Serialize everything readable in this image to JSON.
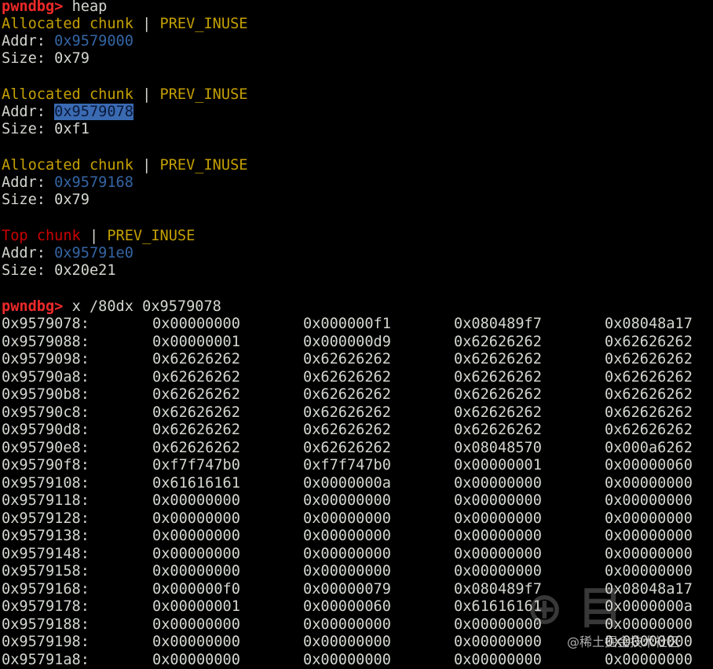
{
  "heap_cmd": {
    "prompt": "pwndbg>",
    "command": " heap"
  },
  "chunks": [
    {
      "title": "Allocated chunk",
      "sep": " | ",
      "flag": "PREV_INUSE",
      "addr_label": "Addr: ",
      "addr": "0x9579000",
      "size_label": "Size: ",
      "size": "0x79"
    },
    {
      "title": "Allocated chunk",
      "sep": " | ",
      "flag": "PREV_INUSE",
      "addr_label": "Addr: ",
      "addr": "0x9579078",
      "size_label": "Size: ",
      "size": "0xf1"
    },
    {
      "title": "Allocated chunk",
      "sep": " | ",
      "flag": "PREV_INUSE",
      "addr_label": "Addr: ",
      "addr": "0x9579168",
      "size_label": "Size: ",
      "size": "0x79"
    },
    {
      "title": "Top chunk",
      "sep": " | ",
      "flag": "PREV_INUSE",
      "addr_label": "Addr: ",
      "addr": "0x95791e0",
      "size_label": "Size: ",
      "size": "0x20e21"
    }
  ],
  "dump_cmd": {
    "prompt": "pwndbg>",
    "command": " x /80dx 0x9579078"
  },
  "dump_rows": [
    [
      "0x9579078:",
      "0x00000000",
      "0x000000f1",
      "0x080489f7",
      "0x08048a17"
    ],
    [
      "0x9579088:",
      "0x00000001",
      "0x000000d9",
      "0x62626262",
      "0x62626262"
    ],
    [
      "0x9579098:",
      "0x62626262",
      "0x62626262",
      "0x62626262",
      "0x62626262"
    ],
    [
      "0x95790a8:",
      "0x62626262",
      "0x62626262",
      "0x62626262",
      "0x62626262"
    ],
    [
      "0x95790b8:",
      "0x62626262",
      "0x62626262",
      "0x62626262",
      "0x62626262"
    ],
    [
      "0x95790c8:",
      "0x62626262",
      "0x62626262",
      "0x62626262",
      "0x62626262"
    ],
    [
      "0x95790d8:",
      "0x62626262",
      "0x62626262",
      "0x62626262",
      "0x62626262"
    ],
    [
      "0x95790e8:",
      "0x62626262",
      "0x62626262",
      "0x08048570",
      "0x000a6262"
    ],
    [
      "0x95790f8:",
      "0xf7f747b0",
      "0xf7f747b0",
      "0x00000001",
      "0x00000060"
    ],
    [
      "0x9579108:",
      "0x61616161",
      "0x0000000a",
      "0x00000000",
      "0x00000000"
    ],
    [
      "0x9579118:",
      "0x00000000",
      "0x00000000",
      "0x00000000",
      "0x00000000"
    ],
    [
      "0x9579128:",
      "0x00000000",
      "0x00000000",
      "0x00000000",
      "0x00000000"
    ],
    [
      "0x9579138:",
      "0x00000000",
      "0x00000000",
      "0x00000000",
      "0x00000000"
    ],
    [
      "0x9579148:",
      "0x00000000",
      "0x00000000",
      "0x00000000",
      "0x00000000"
    ],
    [
      "0x9579158:",
      "0x00000000",
      "0x00000000",
      "0x00000000",
      "0x00000000"
    ],
    [
      "0x9579168:",
      "0x000000f0",
      "0x00000079",
      "0x080489f7",
      "0x08048a17"
    ],
    [
      "0x9579178:",
      "0x00000001",
      "0x00000060",
      "0x61616161",
      "0x0000000a"
    ],
    [
      "0x9579188:",
      "0x00000000",
      "0x00000000",
      "0x00000000",
      "0x00000000"
    ],
    [
      "0x9579198:",
      "0x00000000",
      "0x00000000",
      "0x00000000",
      "0x00000000"
    ],
    [
      "0x95791a8:",
      "0x00000000",
      "0x00000000",
      "0x00000000",
      "0x00000000"
    ]
  ],
  "watermark": {
    "text": "@稀土掘金技术社区"
  }
}
